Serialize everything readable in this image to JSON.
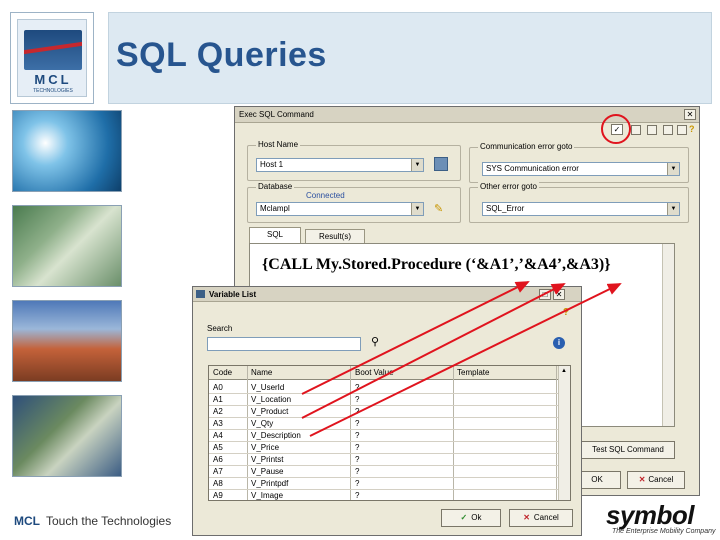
{
  "slide": {
    "title": "SQL Queries",
    "logo_letters": "MCL",
    "logo_sub": "TECHNOLOGIES",
    "footer_brand": "MCL",
    "footer_tagline": "Touch the Technologies",
    "symbol_logo": "symbol",
    "symbol_tagline": "The Enterprise Mobility Company"
  },
  "sql_window": {
    "title": "Exec SQL Command",
    "host_group_label": "Host Name",
    "host_value": "Host 1",
    "database_group_label": "Database",
    "connected_text": "Connected",
    "database_value": "Mclampl",
    "comm_group_label": "Communication error goto",
    "comm_value": "SYS Communication error",
    "other_group_label": "Other error goto",
    "other_value": "SQL_Error",
    "tabs": [
      "SQL",
      "Result(s)"
    ],
    "sql_text": "{CALL My.Stored.Procedure (‘&A1’,’&A4’,&A3)}",
    "test_button": "Test SQL Command",
    "ok_button": "OK",
    "cancel_button": "Cancel"
  },
  "variable_list": {
    "title": "Variable List",
    "search_label": "Search",
    "search_value": "",
    "columns": [
      "Code",
      "Name",
      "Boot Value",
      "Template"
    ],
    "rows": [
      {
        "code": "A0",
        "name": "V_UserId",
        "boot": "?"
      },
      {
        "code": "A1",
        "name": "V_Location",
        "boot": "?"
      },
      {
        "code": "A2",
        "name": "V_Product",
        "boot": "?"
      },
      {
        "code": "A3",
        "name": "V_Qty",
        "boot": "?"
      },
      {
        "code": "A4",
        "name": "V_Description",
        "boot": "?"
      },
      {
        "code": "A5",
        "name": "V_Price",
        "boot": "?"
      },
      {
        "code": "A6",
        "name": "V_Printst",
        "boot": "?"
      },
      {
        "code": "A7",
        "name": "V_Pause",
        "boot": "?"
      },
      {
        "code": "A8",
        "name": "V_Printpdf",
        "boot": "?"
      },
      {
        "code": "A9",
        "name": "V_Image",
        "boot": "?"
      }
    ],
    "ok_button": "Ok",
    "cancel_button": "Cancel"
  },
  "colors": {
    "title_text": "#27558f",
    "title_bg": "#dde9f2",
    "annotation_red": "#e0141e",
    "window_bg": "#ece9d8"
  },
  "icons": [
    "check-icon",
    "search-icon",
    "info-icon",
    "help-icon",
    "close-icon",
    "pencil-icon",
    "computer-icon"
  ]
}
